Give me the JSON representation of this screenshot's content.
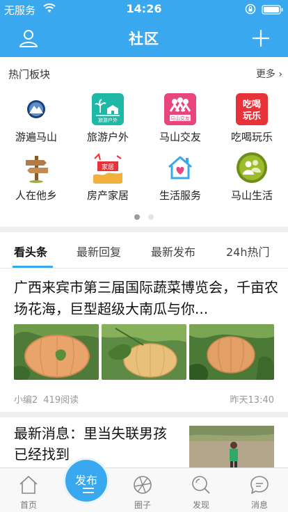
{
  "status_bar": {
    "carrier": "无服务",
    "time": "14:26"
  },
  "nav": {
    "title": "社区"
  },
  "hot": {
    "label": "热门板块",
    "more": "更多 ›",
    "items": [
      {
        "label": "游遍马山",
        "icon": "mountain-emblem-icon"
      },
      {
        "label": "旅游户外",
        "icon": "travel-palm-icon"
      },
      {
        "label": "马山交友",
        "icon": "friends-icon"
      },
      {
        "label": "吃喝玩乐",
        "icon": "food-fun-icon"
      },
      {
        "label": "人在他乡",
        "icon": "signpost-icon"
      },
      {
        "label": "房产家居",
        "icon": "home-banner-icon"
      },
      {
        "label": "生活服务",
        "icon": "house-heart-icon"
      },
      {
        "label": "马山生活",
        "icon": "people-icon"
      }
    ],
    "pages": 2,
    "current_page": 1
  },
  "tabs": [
    "看头条",
    "最新回复",
    "最新发布",
    "24h热门"
  ],
  "article1": {
    "title": "广西来宾市第三届国际蔬菜博览会，千亩农场花海，巨型超级大南瓜与你...",
    "author": "小编2",
    "reads": "419阅读",
    "time": "昨天13:40"
  },
  "article2": {
    "title": "最新消息：里当失联男孩已经找到"
  },
  "tabbar": {
    "home": "首页",
    "publish": "发布",
    "circle": "圈子",
    "discover": "发现",
    "messages": "消息"
  },
  "colors": {
    "accent": "#3aa8ef",
    "pink": "#e8457a",
    "red": "#e8323a",
    "teal": "#1fb8a6",
    "olive": "#7a9a1a"
  }
}
